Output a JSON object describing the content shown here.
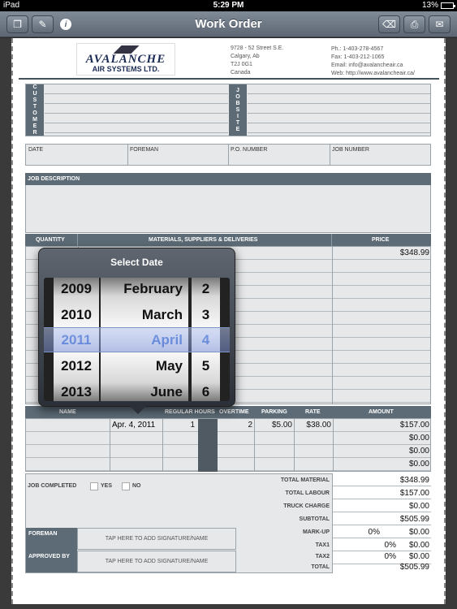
{
  "status": {
    "carrier": "iPad",
    "time": "5:29 PM",
    "battery": "13%"
  },
  "navbar": {
    "title": "Work Order"
  },
  "company": {
    "logo_line1": "AVALANCHE",
    "logo_line2": "AIR SYSTEMS LTD.",
    "address": [
      "9728 - 52 Street S.E.",
      "Calgary, Ab",
      "T2J 0G1",
      "Canada"
    ],
    "contact": [
      "Ph.: 1-403-278-4567",
      "Fax: 1-403-212-1065",
      "Email: info@avalancheair.ca",
      "Web: http://www.avalancheair.ca/"
    ]
  },
  "labels": {
    "customer": [
      "C",
      "U",
      "S",
      "T",
      "O",
      "M",
      "E",
      "R"
    ],
    "jobsite": [
      "J",
      "O",
      "B",
      "S",
      "I",
      "T",
      "E"
    ],
    "date": "DATE",
    "foreman": "FOREMAN",
    "po_number": "P.O. NUMBER",
    "job_number": "JOB NUMBER",
    "job_description": "JOB DESCRIPTION",
    "quantity": "QUANTITY",
    "materials": "MATERIALS, SUPPLIERS & DELIVERIES",
    "price": "PRICE",
    "name": "NAME",
    "regular_hours": "REGULAR HOURS",
    "overtime": "OVERTIME",
    "parking": "PARKING",
    "rate": "RATE",
    "amount": "AMOUNT",
    "job_completed": "JOB COMPLETED",
    "yes": "YES",
    "no": "NO",
    "foreman_sig": "FOREMAN",
    "approved_by": "APPROVED BY",
    "tap_signature": "TAP HERE TO ADD SIGNATURE/NAME"
  },
  "materials": {
    "first_price": "$348.99"
  },
  "labour": {
    "row1": {
      "date": "Apr. 4, 2011",
      "regular": "1",
      "overtime": "2",
      "parking": "$5.00",
      "rate": "$38.00",
      "amount": "$157.00"
    },
    "other_amounts": [
      "$0.00",
      "$0.00",
      "$0.00"
    ]
  },
  "totals": {
    "total_material_label": "TOTAL MATERIAL",
    "total_material": "$348.99",
    "total_labour_label": "TOTAL LABOUR",
    "total_labour": "$157.00",
    "truck_charge_label": "TRUCK CHARGE",
    "truck_charge": "$0.00",
    "subtotal_label": "SUBTOTAL",
    "subtotal": "$505.99",
    "markup_label": "MARK-UP",
    "markup_pct": "0%",
    "markup": "$0.00",
    "tax1_label": "TAX1",
    "tax1_pct": "0%",
    "tax1": "$0.00",
    "tax2_label": "TAX2",
    "tax2_pct": "0%",
    "tax2": "$0.00",
    "total_label": "TOTAL",
    "total": "$505.99"
  },
  "picker": {
    "title": "Select Date",
    "years": [
      "2009",
      "2010",
      "2011",
      "2012",
      "2013"
    ],
    "months": [
      "February",
      "March",
      "April",
      "May",
      "June"
    ],
    "days": [
      "2",
      "3",
      "4",
      "5",
      "6"
    ],
    "selected_index": 2
  }
}
